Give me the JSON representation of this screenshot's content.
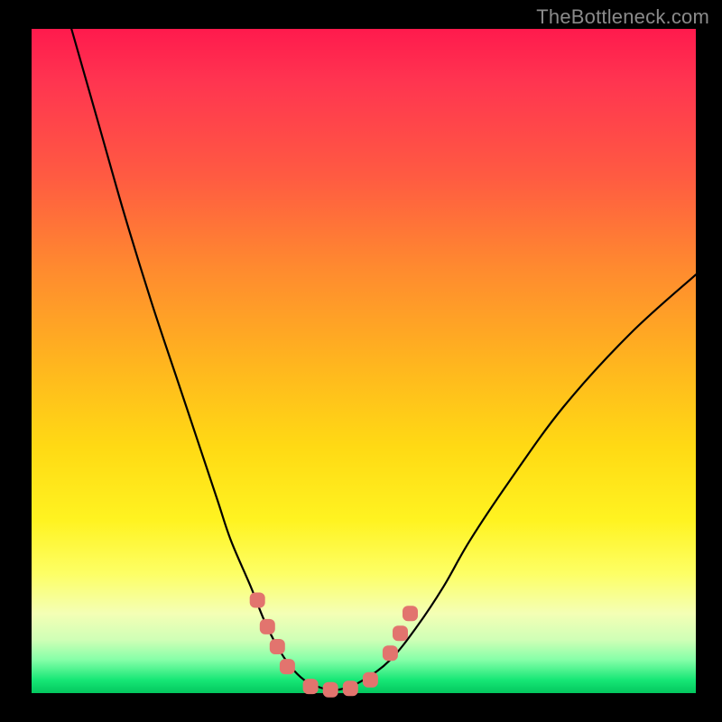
{
  "watermark": "TheBottleneck.com",
  "colors": {
    "frame": "#000000",
    "curveStroke": "#000000",
    "markerFill": "#e2746e",
    "gradientStops": [
      "#ff1a4d",
      "#ff3550",
      "#ff5a42",
      "#ff8a2f",
      "#ffb41f",
      "#ffda14",
      "#fff321",
      "#fdff65",
      "#f4ffb5",
      "#cfffb6",
      "#85ffa8",
      "#17e776",
      "#03c75e"
    ]
  },
  "chart_data": {
    "type": "line",
    "title": "",
    "xlabel": "",
    "ylabel": "",
    "xlim": [
      0,
      100
    ],
    "ylim": [
      0,
      100
    ],
    "grid": false,
    "legend": false,
    "series": [
      {
        "name": "bottleneck-curve",
        "x": [
          6,
          10,
          14,
          18,
          22,
          25,
          28,
          30,
          33,
          35,
          37,
          39,
          41,
          43,
          45,
          47,
          50,
          54,
          58,
          62,
          66,
          72,
          80,
          90,
          100
        ],
        "y": [
          100,
          86,
          72,
          59,
          47,
          38,
          29,
          23,
          16,
          11,
          7,
          4,
          2,
          1,
          0.5,
          0.7,
          2,
          5,
          10,
          16,
          23,
          32,
          43,
          54,
          63
        ]
      }
    ],
    "markers": {
      "name": "highlight-points",
      "x": [
        34,
        35.5,
        37,
        38.5,
        42,
        45,
        48,
        51,
        54,
        55.5,
        57
      ],
      "y": [
        14,
        10,
        7,
        4,
        1,
        0.5,
        0.7,
        2,
        6,
        9,
        12
      ]
    }
  }
}
